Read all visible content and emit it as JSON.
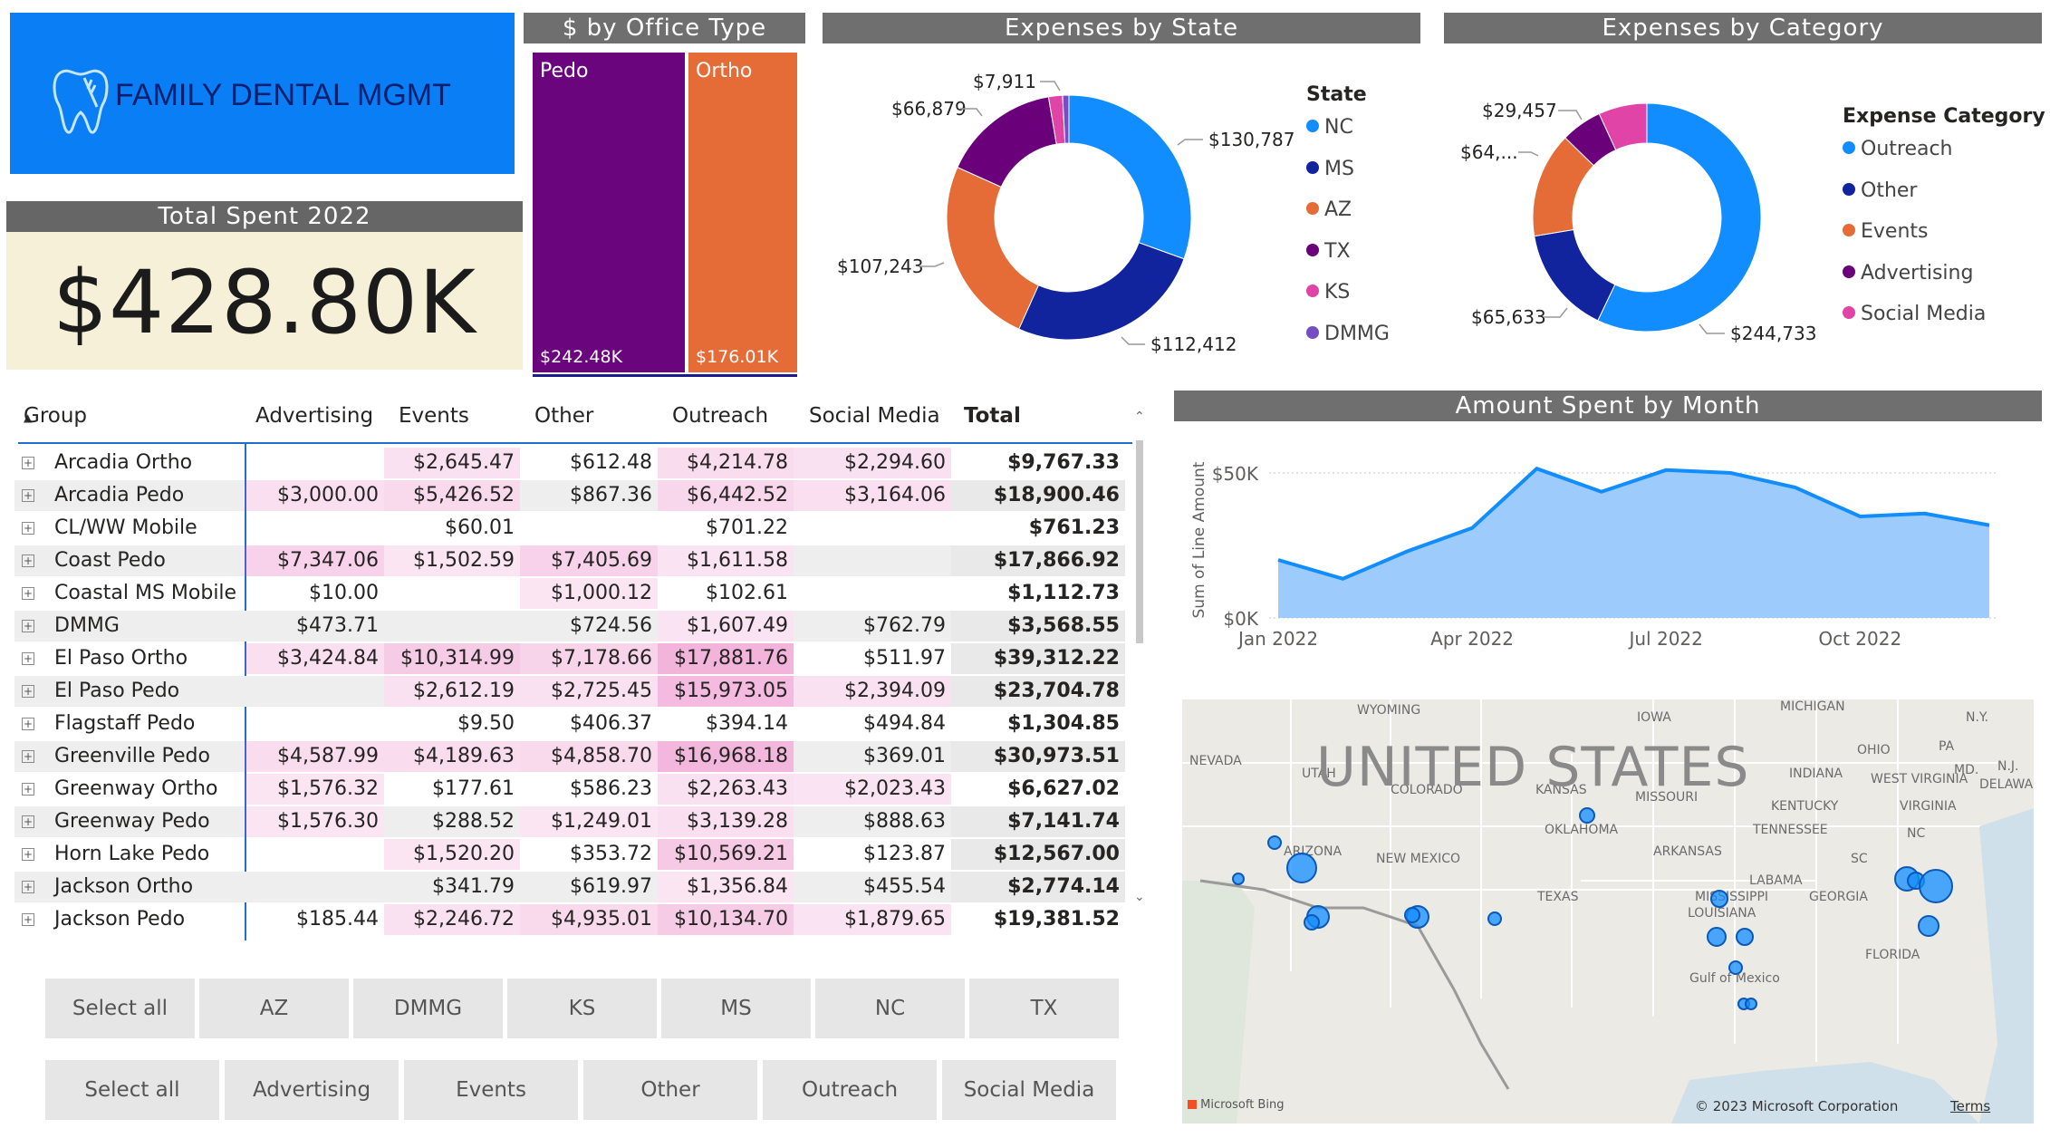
{
  "brand": {
    "name": "FAMILY DENTAL MGMT",
    "icon": "tooth-icon"
  },
  "kpi": {
    "title": "Total Spent 2022",
    "value": "$428.80K"
  },
  "office_type": {
    "title": "$ by Office Type",
    "items": [
      {
        "label": "Pedo",
        "value": "$242.48K",
        "color": "#6b057d"
      },
      {
        "label": "Ortho",
        "value": "$176.01K",
        "color": "#e66c37"
      }
    ]
  },
  "expenses_by_state": {
    "title": "Expenses by State",
    "legend_title": "State",
    "segments": [
      {
        "label": "NC",
        "value": 130787,
        "display": "$130,787",
        "color": "#118dff"
      },
      {
        "label": "MS",
        "value": 112412,
        "display": "$112,412",
        "color": "#12239e"
      },
      {
        "label": "AZ",
        "value": 107243,
        "display": "$107,243",
        "color": "#e66c37"
      },
      {
        "label": "TX",
        "value": 66879,
        "display": "$66,879",
        "color": "#6b007b"
      },
      {
        "label": "KS",
        "value": 7911,
        "display": "$7,911",
        "color": "#e044a7"
      },
      {
        "label": "DMMG",
        "value": 3568,
        "display": "",
        "color": "#744ec2"
      }
    ]
  },
  "expenses_by_category": {
    "title": "Expenses by Category",
    "legend_title": "Expense Category",
    "segments": [
      {
        "label": "Outreach",
        "value": 244733,
        "display": "$244,733",
        "color": "#118dff"
      },
      {
        "label": "Other",
        "value": 65633,
        "display": "$65,633",
        "color": "#12239e"
      },
      {
        "label": "Events",
        "value": 64000,
        "display": "$64,...",
        "color": "#e66c37"
      },
      {
        "label": "Advertising",
        "value": 25000,
        "display": "",
        "color": "#6b007b"
      },
      {
        "label": "Social Media",
        "value": 29457,
        "display": "$29,457",
        "color": "#e044a7"
      }
    ]
  },
  "table": {
    "columns": [
      "Group",
      "Advertising",
      "Events",
      "Other",
      "Outreach",
      "Social Media",
      "Total"
    ],
    "rows": [
      [
        "Arcadia Ortho",
        "",
        "$2,645.47",
        "$612.48",
        "$4,214.78",
        "$2,294.60",
        "$9,767.33"
      ],
      [
        "Arcadia Pedo",
        "$3,000.00",
        "$5,426.52",
        "$867.36",
        "$6,442.52",
        "$3,164.06",
        "$18,900.46"
      ],
      [
        "CL/WW Mobile",
        "",
        "$60.01",
        "",
        "$701.22",
        "",
        "$761.23"
      ],
      [
        "Coast Pedo",
        "$7,347.06",
        "$1,502.59",
        "$7,405.69",
        "$1,611.58",
        "",
        "$17,866.92"
      ],
      [
        "Coastal MS Mobile",
        "$10.00",
        "",
        "$1,000.12",
        "$102.61",
        "",
        "$1,112.73"
      ],
      [
        "DMMG",
        "$473.71",
        "",
        "$724.56",
        "$1,607.49",
        "$762.79",
        "$3,568.55"
      ],
      [
        "El Paso Ortho",
        "$3,424.84",
        "$10,314.99",
        "$7,178.66",
        "$17,881.76",
        "$511.97",
        "$39,312.22"
      ],
      [
        "El Paso Pedo",
        "",
        "$2,612.19",
        "$2,725.45",
        "$15,973.05",
        "$2,394.09",
        "$23,704.78"
      ],
      [
        "Flagstaff Pedo",
        "",
        "$9.50",
        "$406.37",
        "$394.14",
        "$494.84",
        "$1,304.85"
      ],
      [
        "Greenville Pedo",
        "$4,587.99",
        "$4,189.63",
        "$4,858.70",
        "$16,968.18",
        "$369.01",
        "$30,973.51"
      ],
      [
        "Greenway Ortho",
        "$1,576.32",
        "$177.61",
        "$586.23",
        "$2,263.43",
        "$2,023.43",
        "$6,627.02"
      ],
      [
        "Greenway Pedo",
        "$1,576.30",
        "$288.52",
        "$1,249.01",
        "$3,139.28",
        "$888.63",
        "$7,141.74"
      ],
      [
        "Horn Lake Pedo",
        "",
        "$1,520.20",
        "$353.72",
        "$10,569.21",
        "$123.87",
        "$12,567.00"
      ],
      [
        "Jackson Ortho",
        "",
        "$341.79",
        "$619.97",
        "$1,356.84",
        "$455.54",
        "$2,774.14"
      ],
      [
        "Jackson Pedo",
        "$185.44",
        "$2,246.72",
        "$4,935.01",
        "$10,134.70",
        "$1,879.65",
        "$19,381.52"
      ]
    ]
  },
  "state_slicer": [
    "Select all",
    "AZ",
    "DMMG",
    "KS",
    "MS",
    "NC",
    "TX"
  ],
  "category_slicer": [
    "Select all",
    "Advertising",
    "Events",
    "Other",
    "Outreach",
    "Social Media"
  ],
  "chart_data": {
    "type": "area",
    "title": "Amount Spent by Month",
    "ylabel": "Sum of Line Amount",
    "xlabel": "",
    "x": [
      "Jan 2022",
      "Feb 2022",
      "Mar 2022",
      "Apr 2022",
      "May 2022",
      "Jun 2022",
      "Jul 2022",
      "Aug 2022",
      "Sep 2022",
      "Oct 2022",
      "Nov 2022",
      "Dec 2022"
    ],
    "x_tick_labels": [
      "Jan 2022",
      "Apr 2022",
      "Jul 2022",
      "Oct 2022"
    ],
    "y_tick_labels": [
      "$0K",
      "$50K"
    ],
    "ylim": [
      0,
      60000
    ],
    "series": [
      {
        "values": [
          20000,
          13500,
          23000,
          31000,
          51500,
          43500,
          51000,
          50000,
          45000,
          35000,
          36000,
          32000
        ]
      }
    ],
    "color": "#118dff"
  },
  "map": {
    "country_label": "UNITED STATES",
    "place_labels": [
      "WYOMING",
      "IOWA",
      "MICHIGAN",
      "N.Y.",
      "NEVADA",
      "UTAH",
      "COLORADO",
      "KANSAS",
      "MISSOURI",
      "OHIO",
      "INDIANA",
      "PA",
      "N.J.",
      "MD.",
      "DELAWARE",
      "WEST VIRGINIA",
      "VIRGINIA",
      "KENTUCKY",
      "TENNESSEE",
      "OKLAHOMA",
      "ARIZONA",
      "NEW MEXICO",
      "ARKANSAS",
      "TEXAS",
      "MISSISSIPPI",
      "LABAMA",
      "GEORGIA",
      "LOUISIANA",
      "SC",
      "NC",
      "FLORIDA",
      "Gulf of Mexico"
    ],
    "attribution": "© 2023 Microsoft Corporation",
    "terms": "Terms",
    "provider": "Microsoft Bing"
  }
}
